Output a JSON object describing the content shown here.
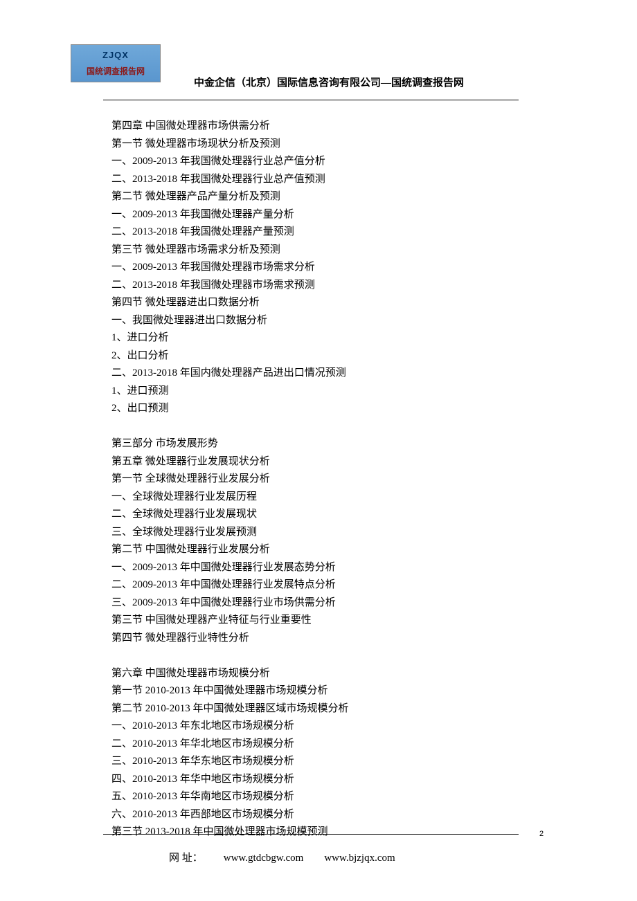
{
  "logo": {
    "top": "ZJQX",
    "bottom": "国统调查报告网"
  },
  "header": "中金企信（北京）国际信息咨询有限公司—国统调查报告网",
  "content": {
    "lines": [
      "第四章 中国微处理器市场供需分析",
      "第一节 微处理器市场现状分析及预测",
      "一、2009-2013 年我国微处理器行业总产值分析",
      "二、2013-2018 年我国微处理器行业总产值预测",
      "第二节 微处理器产品产量分析及预测",
      "一、2009-2013 年我国微处理器产量分析",
      "二、2013-2018 年我国微处理器产量预测",
      "第三节 微处理器市场需求分析及预测",
      "一、2009-2013 年我国微处理器市场需求分析",
      "二、2013-2018 年我国微处理器市场需求预测",
      "第四节 微处理器进出口数据分析",
      "一、我国微处理器进出口数据分析",
      "1、进口分析",
      "2、出口分析",
      "二、2013-2018 年国内微处理器产品进出口情况预测",
      "1、进口预测",
      "2、出口预测",
      "",
      "第三部分 市场发展形势",
      "第五章 微处理器行业发展现状分析",
      "第一节 全球微处理器行业发展分析",
      "一、全球微处理器行业发展历程",
      "二、全球微处理器行业发展现状",
      "三、全球微处理器行业发展预测",
      "第二节 中国微处理器行业发展分析",
      "一、2009-2013 年中国微处理器行业发展态势分析",
      "二、2009-2013 年中国微处理器行业发展特点分析",
      "三、2009-2013 年中国微处理器行业市场供需分析",
      "第三节 中国微处理器产业特征与行业重要性",
      "第四节 微处理器行业特性分析",
      "",
      "第六章 中国微处理器市场规模分析",
      "第一节 2010-2013 年中国微处理器市场规模分析",
      "第二节 2010-2013 年中国微处理器区域市场规模分析",
      "一、2010-2013 年东北地区市场规模分析",
      "二、2010-2013 年华北地区市场规模分析",
      "三、2010-2013 年华东地区市场规模分析",
      "四、2010-2013 年华中地区市场规模分析",
      "五、2010-2013 年华南地区市场规模分析",
      "六、2010-2013 年西部地区市场规模分析",
      "第三节 2013-2018 年中国微处理器市场规模预测"
    ]
  },
  "footer": {
    "label": "网 址：",
    "url1": "www.gtdcbgw.com",
    "url2": "www.bjzjqx.com"
  },
  "pageNumber": "2"
}
